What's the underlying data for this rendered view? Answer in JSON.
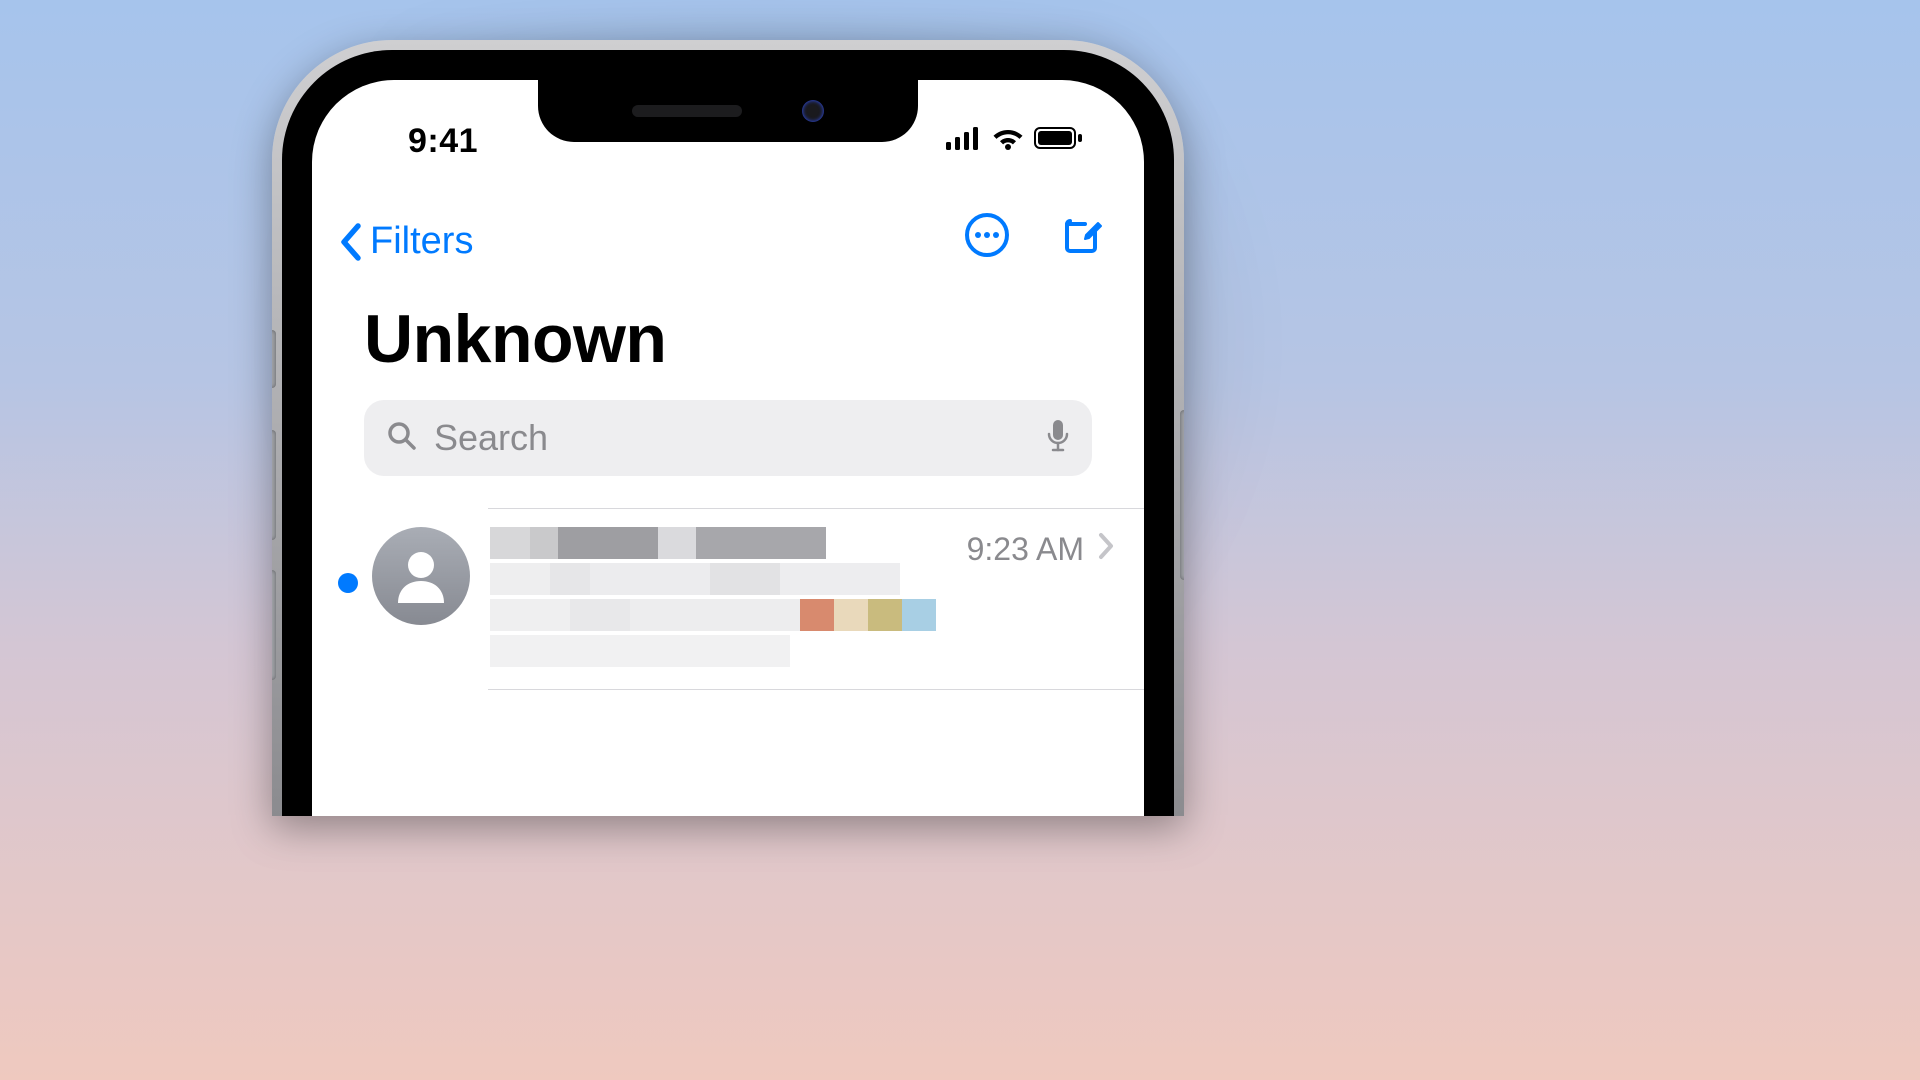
{
  "status": {
    "time": "9:41"
  },
  "nav": {
    "back_label": "Filters"
  },
  "title": "Unknown",
  "search": {
    "placeholder": "Search"
  },
  "messages": [
    {
      "time": "9:23 AM",
      "unread": true
    }
  ],
  "colors": {
    "accent": "#007aff"
  }
}
